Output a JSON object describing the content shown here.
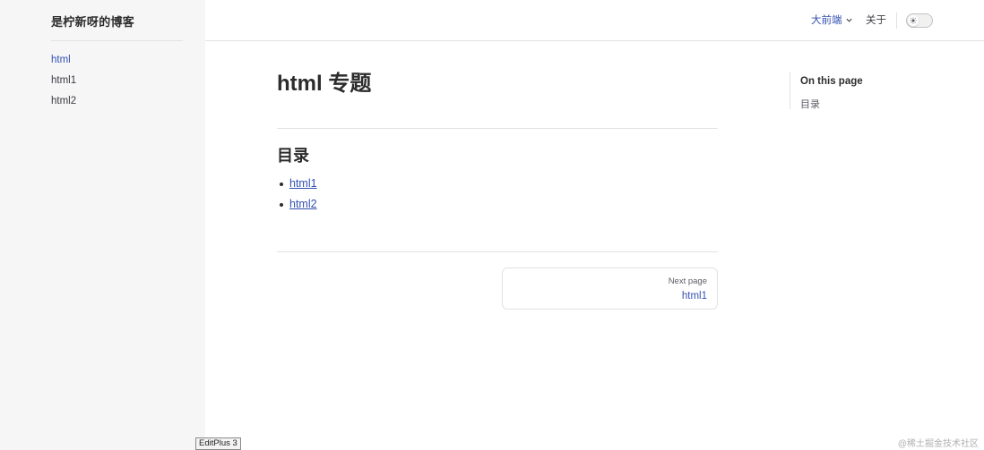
{
  "sidebar": {
    "site_title": "是柠新呀的博客",
    "items": [
      {
        "label": "html",
        "active": true
      },
      {
        "label": "html1",
        "active": false
      },
      {
        "label": "html2",
        "active": false
      }
    ]
  },
  "topnav": {
    "menu_label": "大前端",
    "about_label": "关于",
    "theme_icon": "sun-icon"
  },
  "main": {
    "page_title": "html 专题",
    "section_title": "目录",
    "toc": [
      {
        "label": "html1"
      },
      {
        "label": "html2"
      }
    ],
    "next_page": {
      "desc": "Next page",
      "title": "html1"
    }
  },
  "outline": {
    "title": "On this page",
    "links": [
      {
        "label": "目录"
      }
    ]
  },
  "overlay": {
    "taskbar_label": "EditPlus 3",
    "watermark": "@稀土掘金技术社区"
  },
  "colors": {
    "brand": "#3451b2",
    "sidebar_bg": "#f6f6f7",
    "divider": "#e2e2e3"
  }
}
